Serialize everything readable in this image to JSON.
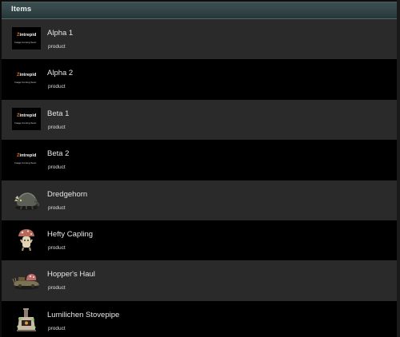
{
  "panel": {
    "title": "Items"
  },
  "placeholder_logo": {
    "brand": "intrepid",
    "mark": "Ź",
    "caption": "Image Coming Soon"
  },
  "items": [
    {
      "name": "Alpha 1",
      "type": "product",
      "thumb": "placeholder-image"
    },
    {
      "name": "Alpha 2",
      "type": "product",
      "thumb": "placeholder-image"
    },
    {
      "name": "Beta 1",
      "type": "product",
      "thumb": "placeholder-image"
    },
    {
      "name": "Beta 2",
      "type": "product",
      "thumb": "placeholder-image"
    },
    {
      "name": "Dredgehorn",
      "type": "product",
      "thumb": "dredgehorn-creature-icon"
    },
    {
      "name": "Hefty Capling",
      "type": "product",
      "thumb": "hefty-capling-mushroom-icon"
    },
    {
      "name": "Hopper's Haul",
      "type": "product",
      "thumb": "hoppers-haul-snail-cart-icon"
    },
    {
      "name": "Lumilichen Stovepipe",
      "type": "product",
      "thumb": "lumilichen-stovepipe-icon"
    }
  ],
  "colors": {
    "header_bg": "#34484a",
    "row_odd": "#2a2a2a",
    "row_even": "#000000",
    "text": "#e6e6e6",
    "logo_accent": "#e0701f"
  }
}
